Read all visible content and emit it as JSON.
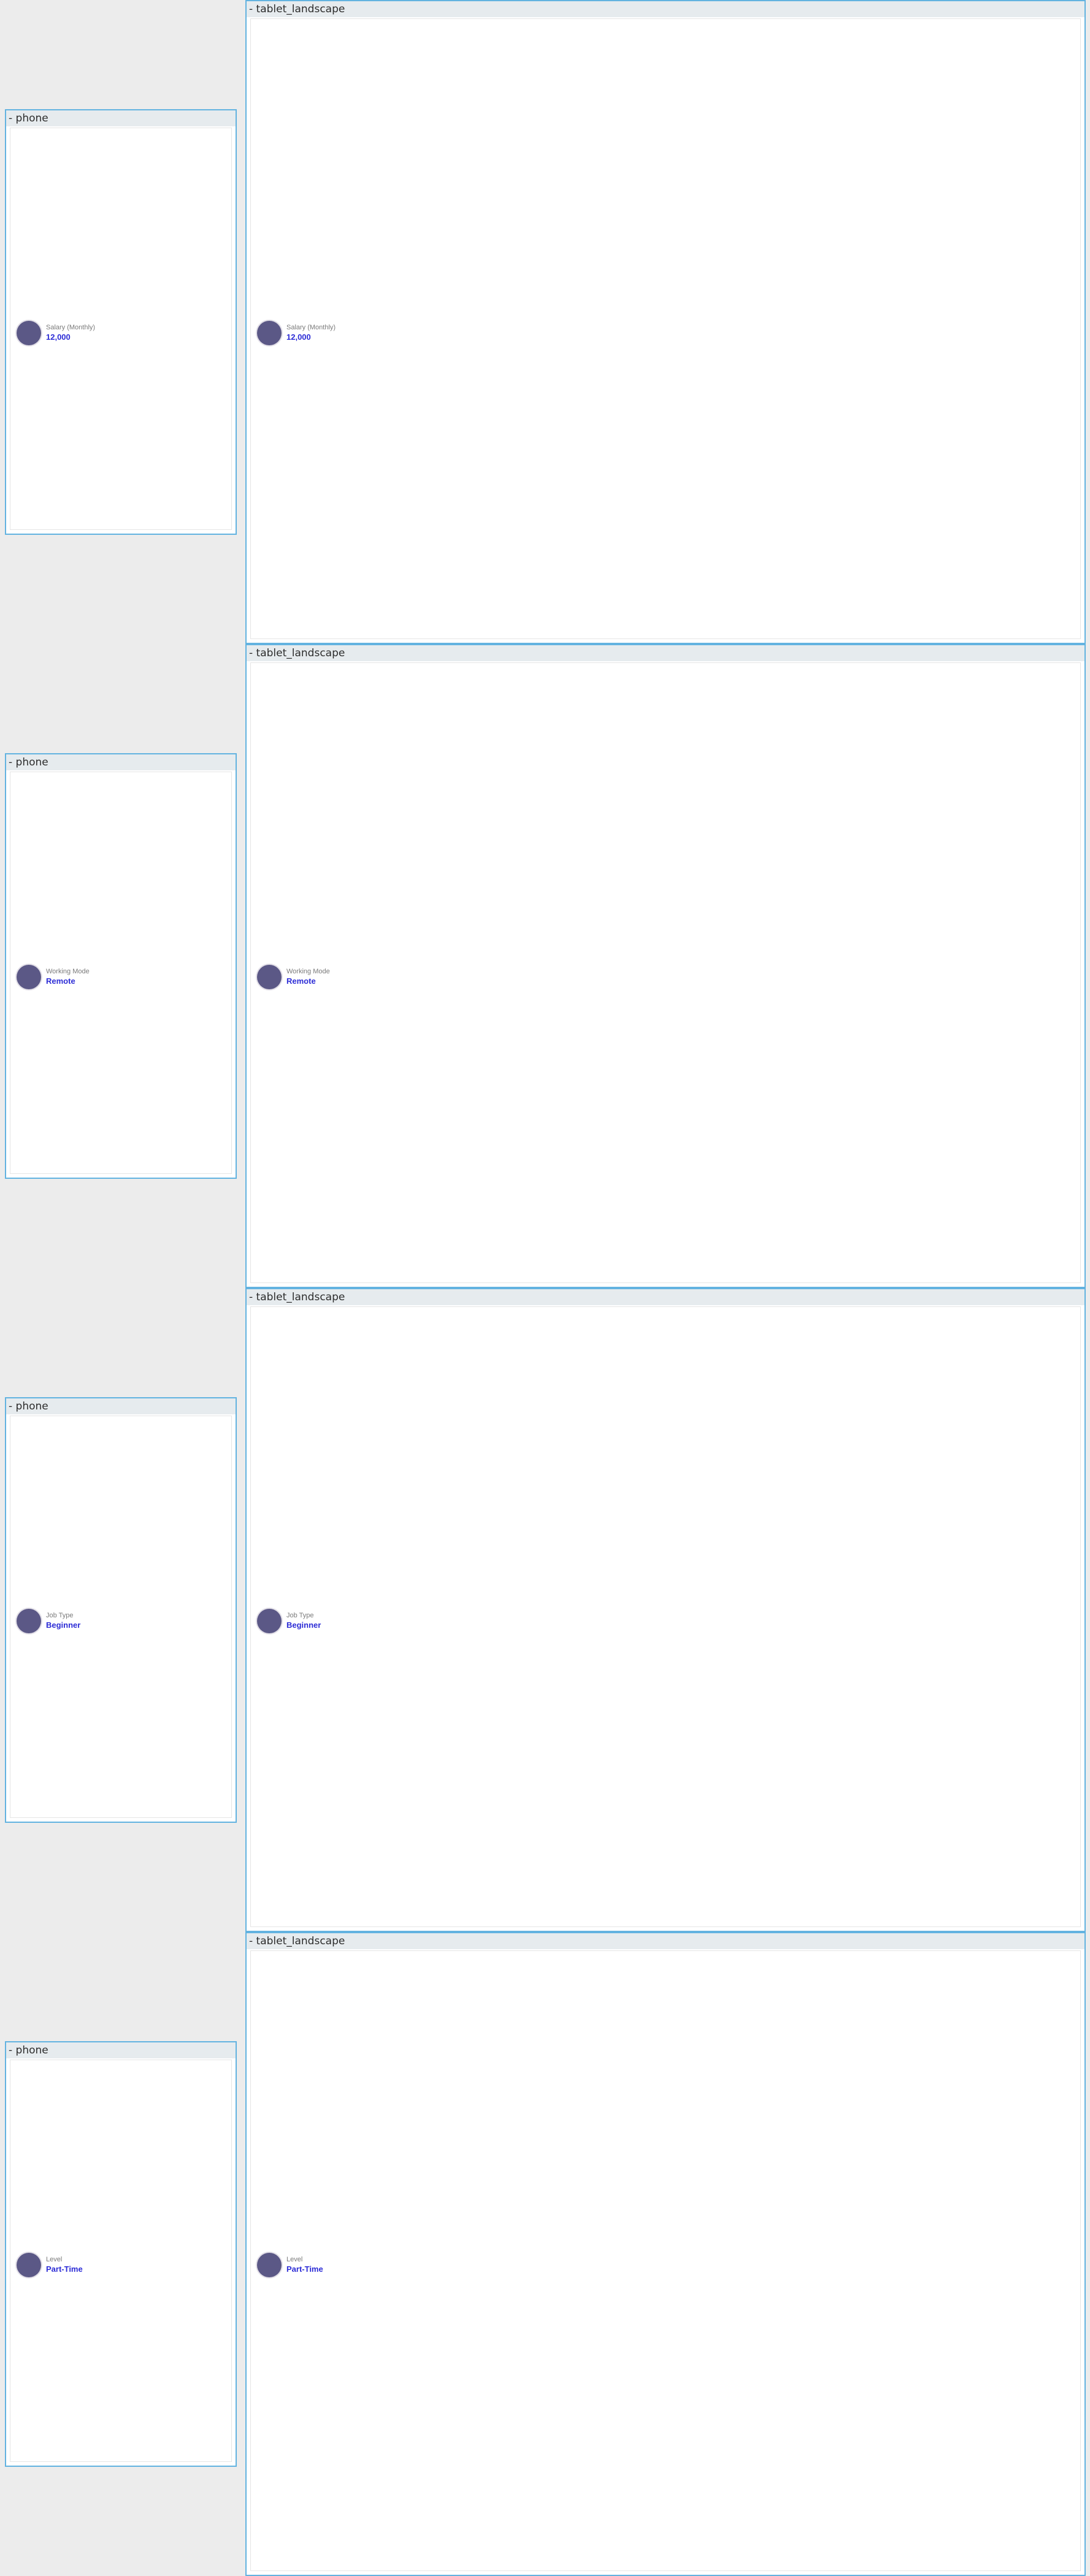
{
  "rows": [
    {
      "phone_title": "- phone",
      "tablet_title": "- tablet_landscape",
      "label": "Salary (Monthly)",
      "value": "12,000"
    },
    {
      "phone_title": "- phone",
      "tablet_title": "- tablet_landscape",
      "label": "Working Mode",
      "value": "Remote"
    },
    {
      "phone_title": "- phone",
      "tablet_title": "- tablet_landscape",
      "label": "Job Type",
      "value": "Beginner"
    },
    {
      "phone_title": "- phone",
      "tablet_title": "- tablet_landscape",
      "label": "Level",
      "value": "Part-Time"
    }
  ],
  "colors": {
    "frame_border": "#63b3e0",
    "header_bg": "#e6ebee",
    "avatar": "#5b5886",
    "value_text": "#2c2cd6",
    "label_text": "#7a7a7a"
  }
}
